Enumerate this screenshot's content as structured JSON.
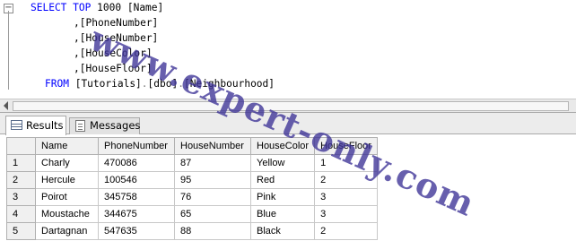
{
  "editor": {
    "lines": {
      "l1": {
        "select_kw": "SELECT",
        "top_kw": "TOP",
        "num": "1000",
        "col": "[Name]"
      },
      "l2": {
        "col": ",[PhoneNumber]"
      },
      "l3": {
        "col": ",[HouseNumber]"
      },
      "l4": {
        "col": ",[HouseColor]"
      },
      "l5": {
        "col": ",[HouseFloor]"
      },
      "l6": {
        "from_kw": "FROM",
        "db": "[Tutorials]",
        "dot1": ".",
        "schema": "[dbo]",
        "dot2": ".",
        "table": "[Neighbourhood]"
      }
    },
    "collapse_glyph": "−"
  },
  "watermark": "www.expert-only.com",
  "tabs": [
    {
      "label": "Results",
      "icon": "results-grid-icon",
      "active": true
    },
    {
      "label": "Messages",
      "icon": "messages-icon",
      "active": false
    }
  ],
  "grid": {
    "columns": [
      "Name",
      "PhoneNumber",
      "HouseNumber",
      "HouseColor",
      "HouseFloor"
    ],
    "rows": [
      {
        "n": "1",
        "cells": [
          "Charly",
          "470086",
          "87",
          "Yellow",
          "1"
        ]
      },
      {
        "n": "2",
        "cells": [
          "Hercule",
          "100546",
          "95",
          "Red",
          "2"
        ]
      },
      {
        "n": "3",
        "cells": [
          "Poirot",
          "345758",
          "76",
          "Pink",
          "3"
        ]
      },
      {
        "n": "4",
        "cells": [
          "Moustache",
          "344675",
          "65",
          "Blue",
          "3"
        ]
      },
      {
        "n": "5",
        "cells": [
          "Dartagnan",
          "547635",
          "88",
          "Black",
          "2"
        ]
      }
    ]
  },
  "colors": {
    "keyword": "#0000ff",
    "object": "#008080",
    "watermark": "#3c3296"
  }
}
